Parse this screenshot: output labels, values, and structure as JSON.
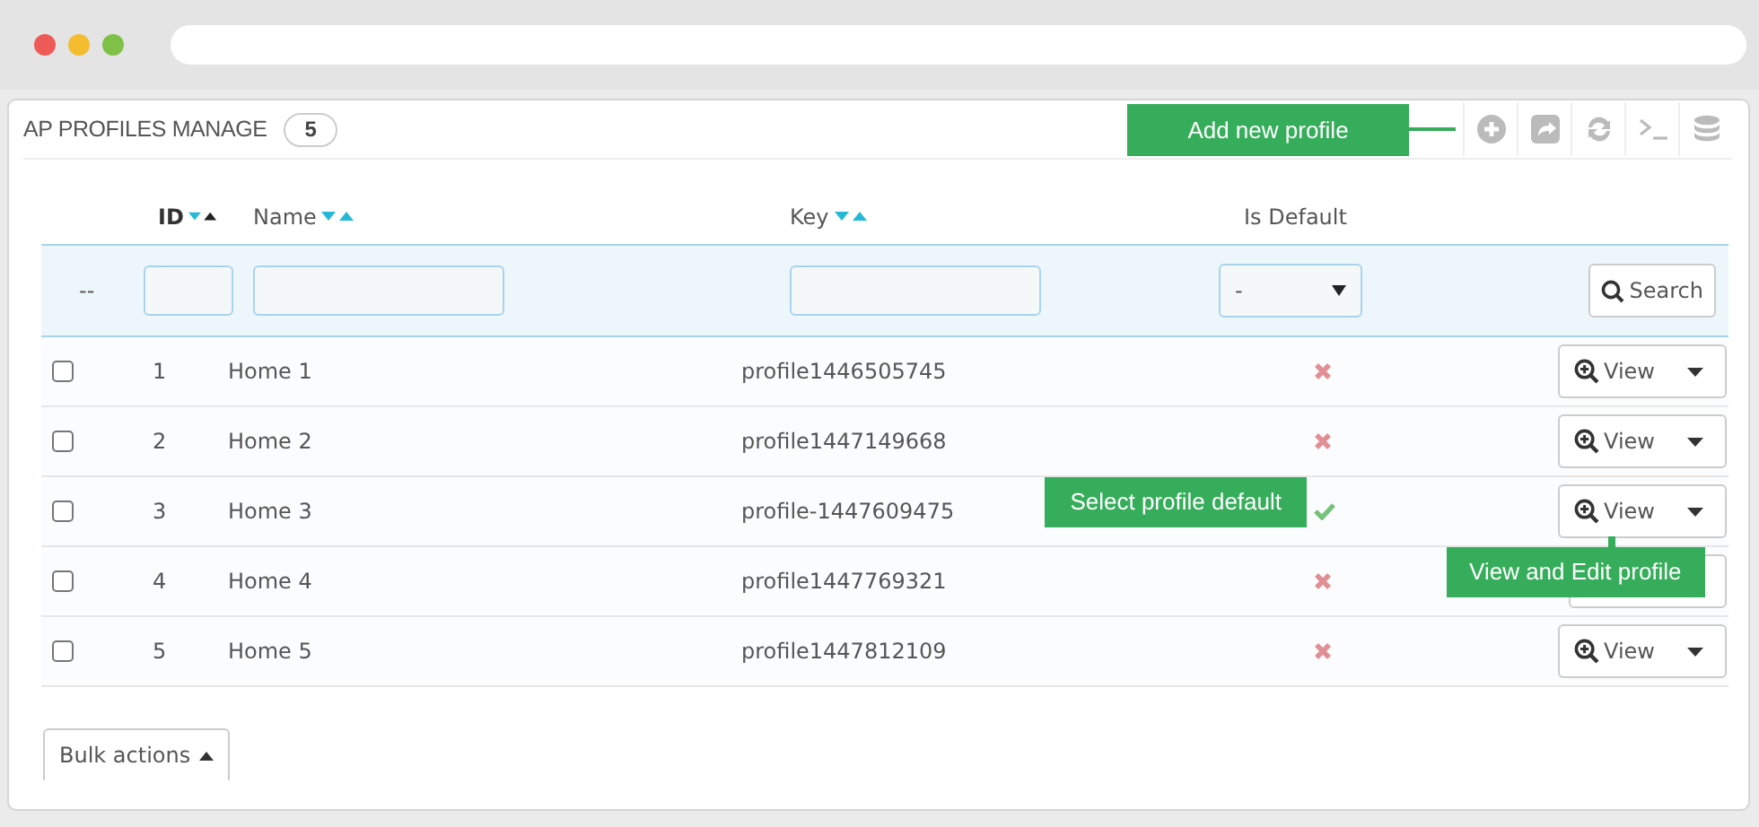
{
  "panel": {
    "title": "AP PROFILES MANAGE",
    "count": "5"
  },
  "toolbar": {
    "callout": "Add new profile",
    "icons": [
      {
        "kind": "add"
      },
      {
        "kind": "export"
      },
      {
        "kind": "refresh"
      },
      {
        "kind": "sql"
      },
      {
        "kind": "database"
      }
    ]
  },
  "table": {
    "columns": [
      {
        "label": "ID",
        "sortable": true,
        "sorted_ascending": true
      },
      {
        "label": "Name",
        "sortable": true,
        "sorted_ascending": false
      },
      {
        "label": "Key",
        "sortable": true,
        "sorted_ascending": false
      },
      {
        "label": "Is Default",
        "sortable": false
      }
    ],
    "filter": {
      "id_marker": "--",
      "select_value": "-",
      "search_button": "Search"
    },
    "rows": [
      {
        "checked": false,
        "id": "1",
        "name": "Home 1",
        "key": "profile1446505745",
        "is_default": false,
        "view": "View"
      },
      {
        "checked": false,
        "id": "2",
        "name": "Home 2",
        "key": "profile1447149668",
        "is_default": false,
        "view": "View"
      },
      {
        "checked": false,
        "id": "3",
        "name": "Home 3",
        "key": "profile-1447609475",
        "is_default": true,
        "view": "View",
        "default_callout": "Select profile default",
        "view_callout": "View and Edit profile"
      },
      {
        "checked": false,
        "id": "4",
        "name": "Home 4",
        "key": "profile1447769321",
        "is_default": false
      },
      {
        "checked": false,
        "id": "5",
        "name": "Home 5",
        "key": "profile1447812109",
        "is_default": false,
        "view": "View"
      }
    ]
  },
  "bulk_actions": "Bulk actions"
}
